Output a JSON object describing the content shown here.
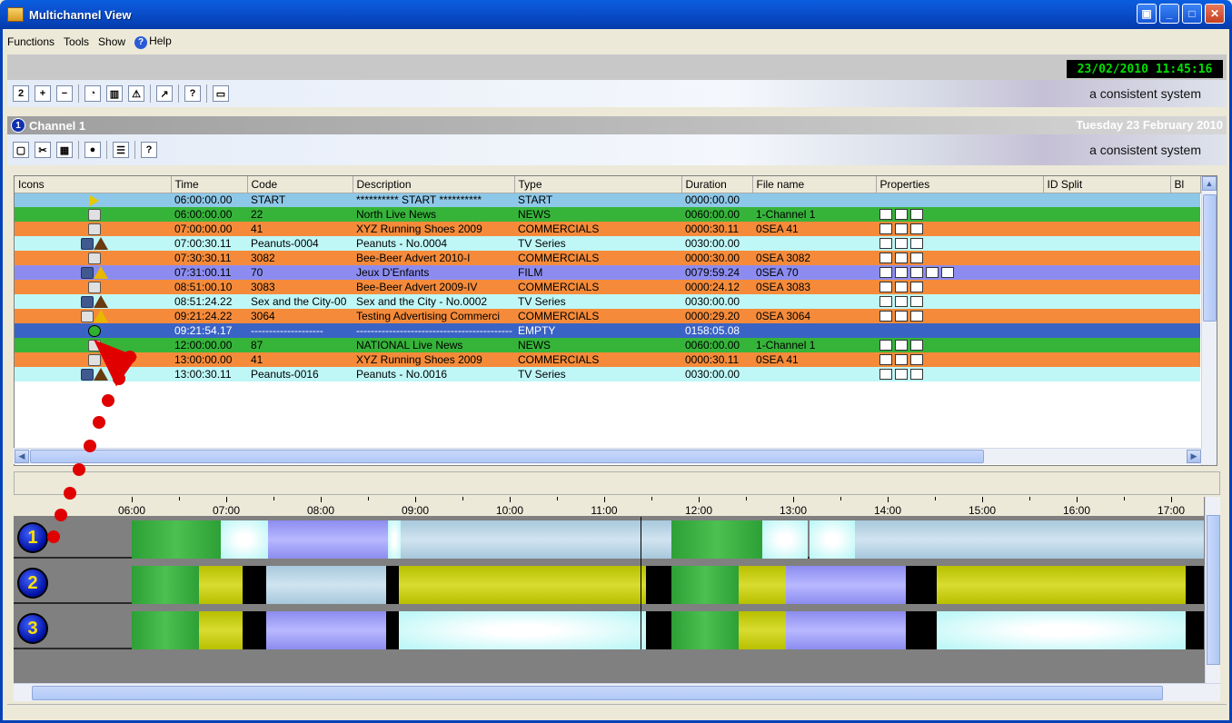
{
  "window": {
    "title": "Multichannel View"
  },
  "menu": [
    "Functions",
    "Tools",
    "Show",
    "Help"
  ],
  "clock": "23/02/2010 11:45:16",
  "brand": "a consistent system",
  "channel": {
    "number": "1",
    "name": "Channel 1",
    "date": "Tuesday 23 February 2010"
  },
  "grid": {
    "columns": [
      "Icons",
      "Time",
      "Code",
      "Description",
      "Type",
      "Duration",
      "File name",
      "Properties",
      "ID Split",
      "Bl"
    ],
    "rows": [
      {
        "icon": "play",
        "time": "06:00:00.00",
        "code": "START",
        "desc": "********** START **********",
        "type": "START",
        "dur": "0000:00.00",
        "file": "",
        "cls": "r-start"
      },
      {
        "icon": "doc",
        "time": "06:00:00.00",
        "code": "22",
        "desc": "North Live News",
        "type": "NEWS",
        "dur": "0060:00.00",
        "file": "1-Channel 1",
        "cls": "r-news"
      },
      {
        "icon": "doc",
        "time": "07:00:00.00",
        "code": "41",
        "desc": "XYZ Running Shoes 2009",
        "type": "COMMERCIALS",
        "dur": "0000:30.11",
        "file": "0SEA     41",
        "cls": "r-com"
      },
      {
        "icon": "tv-warn",
        "time": "07:00:30.11",
        "code": "Peanuts-0004",
        "desc": "Peanuts - No.0004",
        "type": "TV Series",
        "dur": "0030:00.00",
        "file": "",
        "cls": "r-tv"
      },
      {
        "icon": "doc",
        "time": "07:30:30.11",
        "code": "3082",
        "desc": "Bee-Beer Advert 2010-I",
        "type": "COMMERCIALS",
        "dur": "0000:30.00",
        "file": "0SEA     3082",
        "cls": "r-com"
      },
      {
        "icon": "film-warn",
        "time": "07:31:00.11",
        "code": "70",
        "desc": "Jeux D'Enfants",
        "type": "FILM",
        "dur": "0079:59.24",
        "file": "0SEA     70",
        "cls": "r-film"
      },
      {
        "icon": "doc",
        "time": "08:51:00.10",
        "code": "3083",
        "desc": "Bee-Beer Advert 2009-IV",
        "type": "COMMERCIALS",
        "dur": "0000:24.12",
        "file": "0SEA     3083",
        "cls": "r-com"
      },
      {
        "icon": "tv-warn",
        "time": "08:51:24.22",
        "code": "Sex and the City-00",
        "desc": "Sex and the City - No.0002",
        "type": "TV Series",
        "dur": "0030:00.00",
        "file": "",
        "cls": "r-tv"
      },
      {
        "icon": "doc-warn",
        "time": "09:21:24.22",
        "code": "3064",
        "desc": "Testing Advertising Commerci",
        "type": "COMMERCIALS",
        "dur": "0000:29.20",
        "file": "0SEA     3064",
        "cls": "r-com"
      },
      {
        "icon": "empty",
        "time": "09:21:54.17",
        "code": "--------------------",
        "desc": "-------------------------------------------",
        "type": "EMPTY",
        "dur": "0158:05.08",
        "file": "",
        "cls": "r-empty"
      },
      {
        "icon": "doc",
        "time": "12:00:00.00",
        "code": "87",
        "desc": "NATIONAL Live News",
        "type": "NEWS",
        "dur": "0060:00.00",
        "file": "1-Channel 1",
        "cls": "r-news"
      },
      {
        "icon": "doc",
        "time": "13:00:00.00",
        "code": "41",
        "desc": "XYZ Running Shoes 2009",
        "type": "COMMERCIALS",
        "dur": "0000:30.11",
        "file": "0SEA     41",
        "cls": "r-com"
      },
      {
        "icon": "tv-warn",
        "time": "13:00:30.11",
        "code": "Peanuts-0016",
        "desc": "Peanuts - No.0016",
        "type": "TV Series",
        "dur": "0030:00.00",
        "file": "",
        "cls": "r-tv"
      }
    ]
  },
  "timeline": {
    "hours": [
      "06:00",
      "07:00",
      "08:00",
      "09:00",
      "10:00",
      "11:00",
      "12:00",
      "13:00",
      "14:00",
      "15:00",
      "16:00",
      "17:00"
    ],
    "tracks": [
      "1",
      "2",
      "3"
    ]
  }
}
